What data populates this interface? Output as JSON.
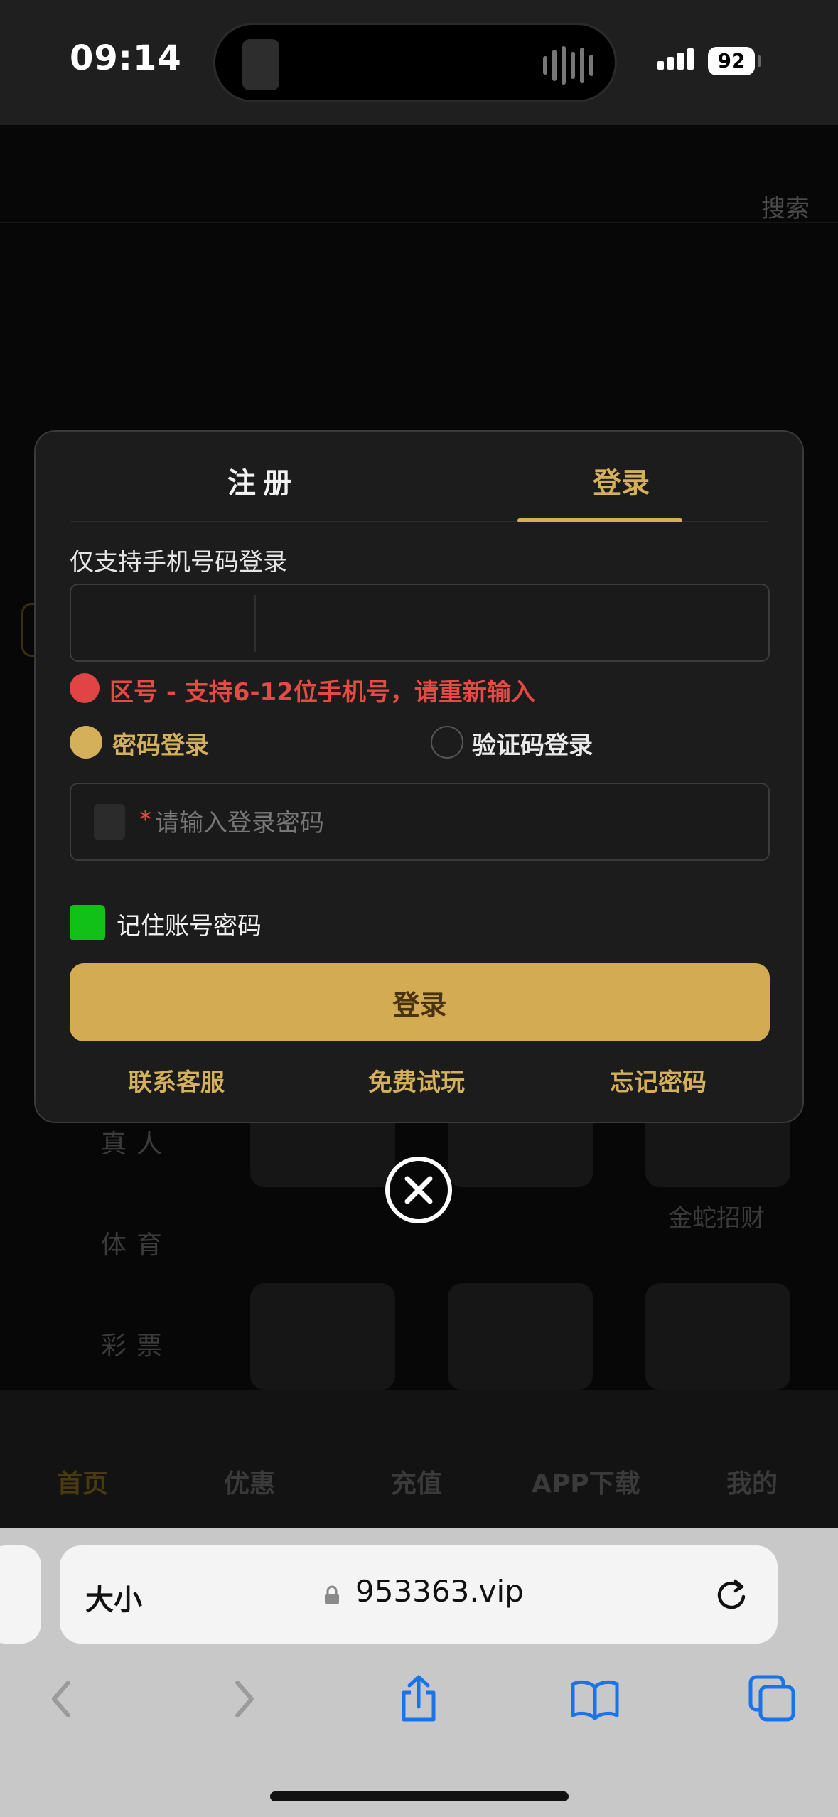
{
  "status_bar": {
    "time": "09:14",
    "battery": "92"
  },
  "background_page": {
    "search_label": "搜索",
    "side_categories": [
      "真人",
      "体育",
      "彩票"
    ],
    "tile_caption": "金蛇招财",
    "bottom_nav": [
      "首页",
      "优惠",
      "充值",
      "APP下载",
      "我的"
    ]
  },
  "login_modal": {
    "tabs": [
      {
        "label": "注册",
        "active": false
      },
      {
        "label": "登录",
        "active": true
      }
    ],
    "phone_hint": "仅支持手机号码登录",
    "phone_value": "",
    "error_text": "区号 - 支持6-12位手机号，请重新输入",
    "login_modes": [
      {
        "label": "密码登录",
        "selected": true
      },
      {
        "label": "验证码登录",
        "selected": false
      }
    ],
    "password_required_mark": "*",
    "password_placeholder": "请输入登录密码",
    "remember_label": "记住账号密码",
    "remember_checked": true,
    "login_button": "登录",
    "footer_links": [
      "联系客服",
      "免费试玩",
      "忘记密码"
    ],
    "accent_color": "#d4b05a",
    "error_color": "#e54a45"
  },
  "browser": {
    "text_size_label": "大小",
    "url": "953363.vip",
    "toolbar_icons": [
      "back-icon",
      "forward-icon",
      "share-icon",
      "bookmarks-icon",
      "tabs-icon"
    ]
  }
}
